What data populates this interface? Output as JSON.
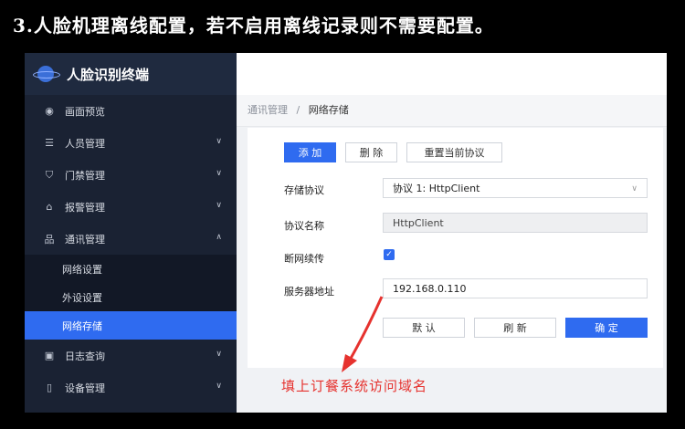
{
  "caption": "3.人脸机理离线配置，若不启用离线记录则不需要配置。",
  "app": {
    "title": "人脸识别终端"
  },
  "sidebar": {
    "items": [
      {
        "label": "画面预览",
        "icon": "eye-icon"
      },
      {
        "label": "人员管理",
        "icon": "person-icon"
      },
      {
        "label": "门禁管理",
        "icon": "shield-icon"
      },
      {
        "label": "报警管理",
        "icon": "alarm-icon"
      },
      {
        "label": "通讯管理",
        "icon": "network-icon"
      },
      {
        "label": "日志查询",
        "icon": "log-icon"
      },
      {
        "label": "设备管理",
        "icon": "device-icon"
      }
    ],
    "subitems": [
      {
        "label": "网络设置"
      },
      {
        "label": "外设设置"
      },
      {
        "label": "网络存储",
        "active": true
      }
    ]
  },
  "breadcrumb": {
    "parent": "通讯管理",
    "separator": "/",
    "current": "网络存储"
  },
  "toolbar": {
    "add_label": "添 加",
    "delete_label": "删 除",
    "reset_label": "重置当前协议"
  },
  "form": {
    "protocol_label": "存储协议",
    "protocol_value": "协议 1: HttpClient",
    "name_label": "协议名称",
    "name_value": "HttpClient",
    "resume_label": "断网续传",
    "resume_checked": true,
    "server_label": "服务器地址",
    "server_value": "192.168.0.110"
  },
  "actions": {
    "default_label": "默 认",
    "refresh_label": "刷 新",
    "confirm_label": "确 定"
  },
  "annotation": {
    "text": "填上订餐系统访问域名",
    "color": "#e6322e"
  },
  "colors": {
    "accent": "#2f6bf0",
    "sidebar": "#1a2233"
  }
}
